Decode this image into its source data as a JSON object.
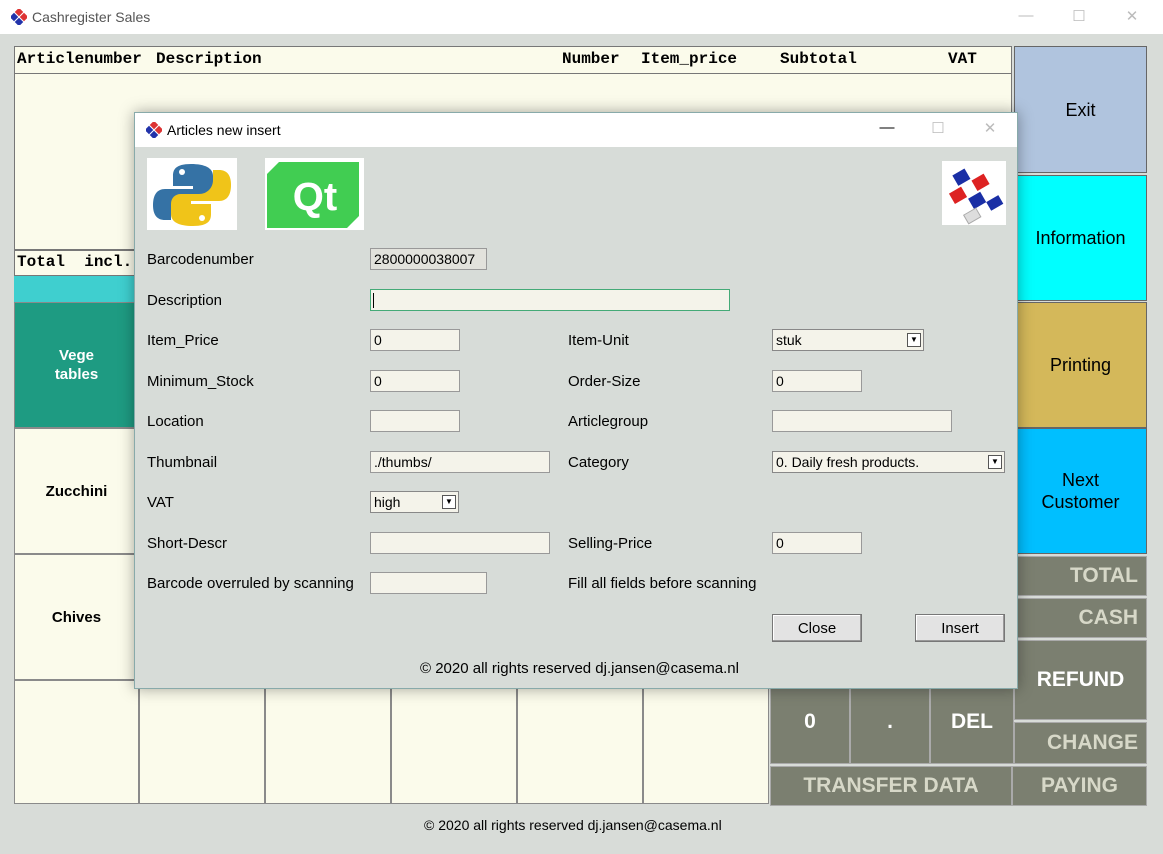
{
  "main": {
    "title": "Cashregister Sales",
    "headers": {
      "articlenumber": "Articlenumber",
      "description": "Description",
      "number": "Number",
      "item_price": "Item_price",
      "subtotal": "Subtotal",
      "vat": "VAT"
    },
    "total_label": "Total  incl.",
    "products": [
      "Vege\ntables",
      "Zucchini",
      "Chives"
    ],
    "right_buttons": {
      "exit": "Exit",
      "information": "Information",
      "printing": "Printing",
      "next_customer": "Next\nCustomer"
    },
    "pay_buttons": {
      "total": "TOTAL",
      "cash": "CASH",
      "refund": "REFUND",
      "change": "CHANGE",
      "transfer": "TRANSFER DATA",
      "paying": "PAYING"
    },
    "keypad": {
      "zero": "0",
      "dot": ".",
      "del": "DEL"
    },
    "footer": "© 2020 all rights reserved dj.jansen@casema.nl",
    "colors": {
      "green": "#1e9b82",
      "exit": "#b0c4de",
      "information": "#00ffff",
      "printing": "#d4b85a",
      "next_customer": "#00bfff",
      "cash_gray": "#7b7f70"
    }
  },
  "dialog": {
    "title": "Articles new insert",
    "fields": {
      "barcode": {
        "label": "Barcodenumber",
        "value": "2800000038007"
      },
      "description": {
        "label": "Description",
        "value": ""
      },
      "item_price": {
        "label": "Item_Price",
        "value": "0"
      },
      "item_unit": {
        "label": "Item-Unit",
        "value": "stuk"
      },
      "minimum_stock": {
        "label": "Minimum_Stock",
        "value": "0"
      },
      "order_size": {
        "label": "Order-Size",
        "value": "0"
      },
      "location": {
        "label": "Location",
        "value": ""
      },
      "articlegroup": {
        "label": "Articlegroup",
        "value": ""
      },
      "thumbnail": {
        "label": "Thumbnail",
        "value": "./thumbs/"
      },
      "category": {
        "label": "Category",
        "value": "0. Daily fresh products."
      },
      "vat": {
        "label": "VAT",
        "value": "high"
      },
      "short_descr": {
        "label": "Short-Descr",
        "value": ""
      },
      "selling_price": {
        "label": "Selling-Price",
        "value": "0"
      },
      "barcode_overruled": {
        "label": "Barcode overruled by scanning",
        "value": ""
      }
    },
    "hint": "Fill all fields before scanning",
    "close_label": "Close",
    "insert_label": "Insert",
    "footer": "© 2020 all rights reserved dj.jansen@casema.nl",
    "logo_text": "Qt"
  }
}
